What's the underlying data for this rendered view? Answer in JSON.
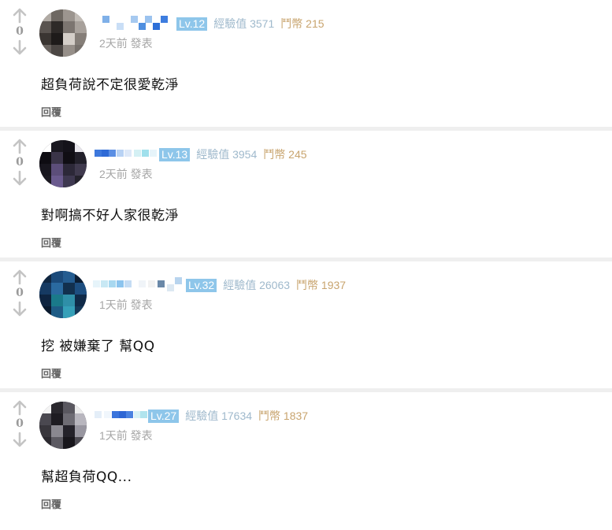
{
  "comments": [
    {
      "votes": "0",
      "level": "Lv.12",
      "exp": "經驗值 3571",
      "coins": "鬥幣 215",
      "time": "2天前 發表",
      "text": "超負荷說不定很愛乾淨",
      "reply": "回覆"
    },
    {
      "votes": "0",
      "level": "Lv.13",
      "exp": "經驗值 3954",
      "coins": "鬥幣 245",
      "time": "2天前 發表",
      "text": "對啊搞不好人家很乾淨",
      "reply": "回覆"
    },
    {
      "votes": "0",
      "level": "Lv.32",
      "exp": "經驗值 26063",
      "coins": "鬥幣 1937",
      "time": "1天前 發表",
      "text": "挖 被嫌棄了 幫QQ",
      "reply": "回覆"
    },
    {
      "votes": "0",
      "level": "Lv.27",
      "exp": "經驗值 17634",
      "coins": "鬥幣 1837",
      "time": "1天前 發表",
      "text": "幫超負荷QQ...",
      "reply": "回覆"
    }
  ],
  "icons": {
    "upvote": "arrow-up-icon",
    "downvote": "arrow-down-icon"
  },
  "colors": {
    "level_badge": "#8ec6ea",
    "exp_text": "#9fb9cc",
    "coin_text": "#c8a46e",
    "vote_gray": "#c4c4c4",
    "separator": "#efefef"
  }
}
